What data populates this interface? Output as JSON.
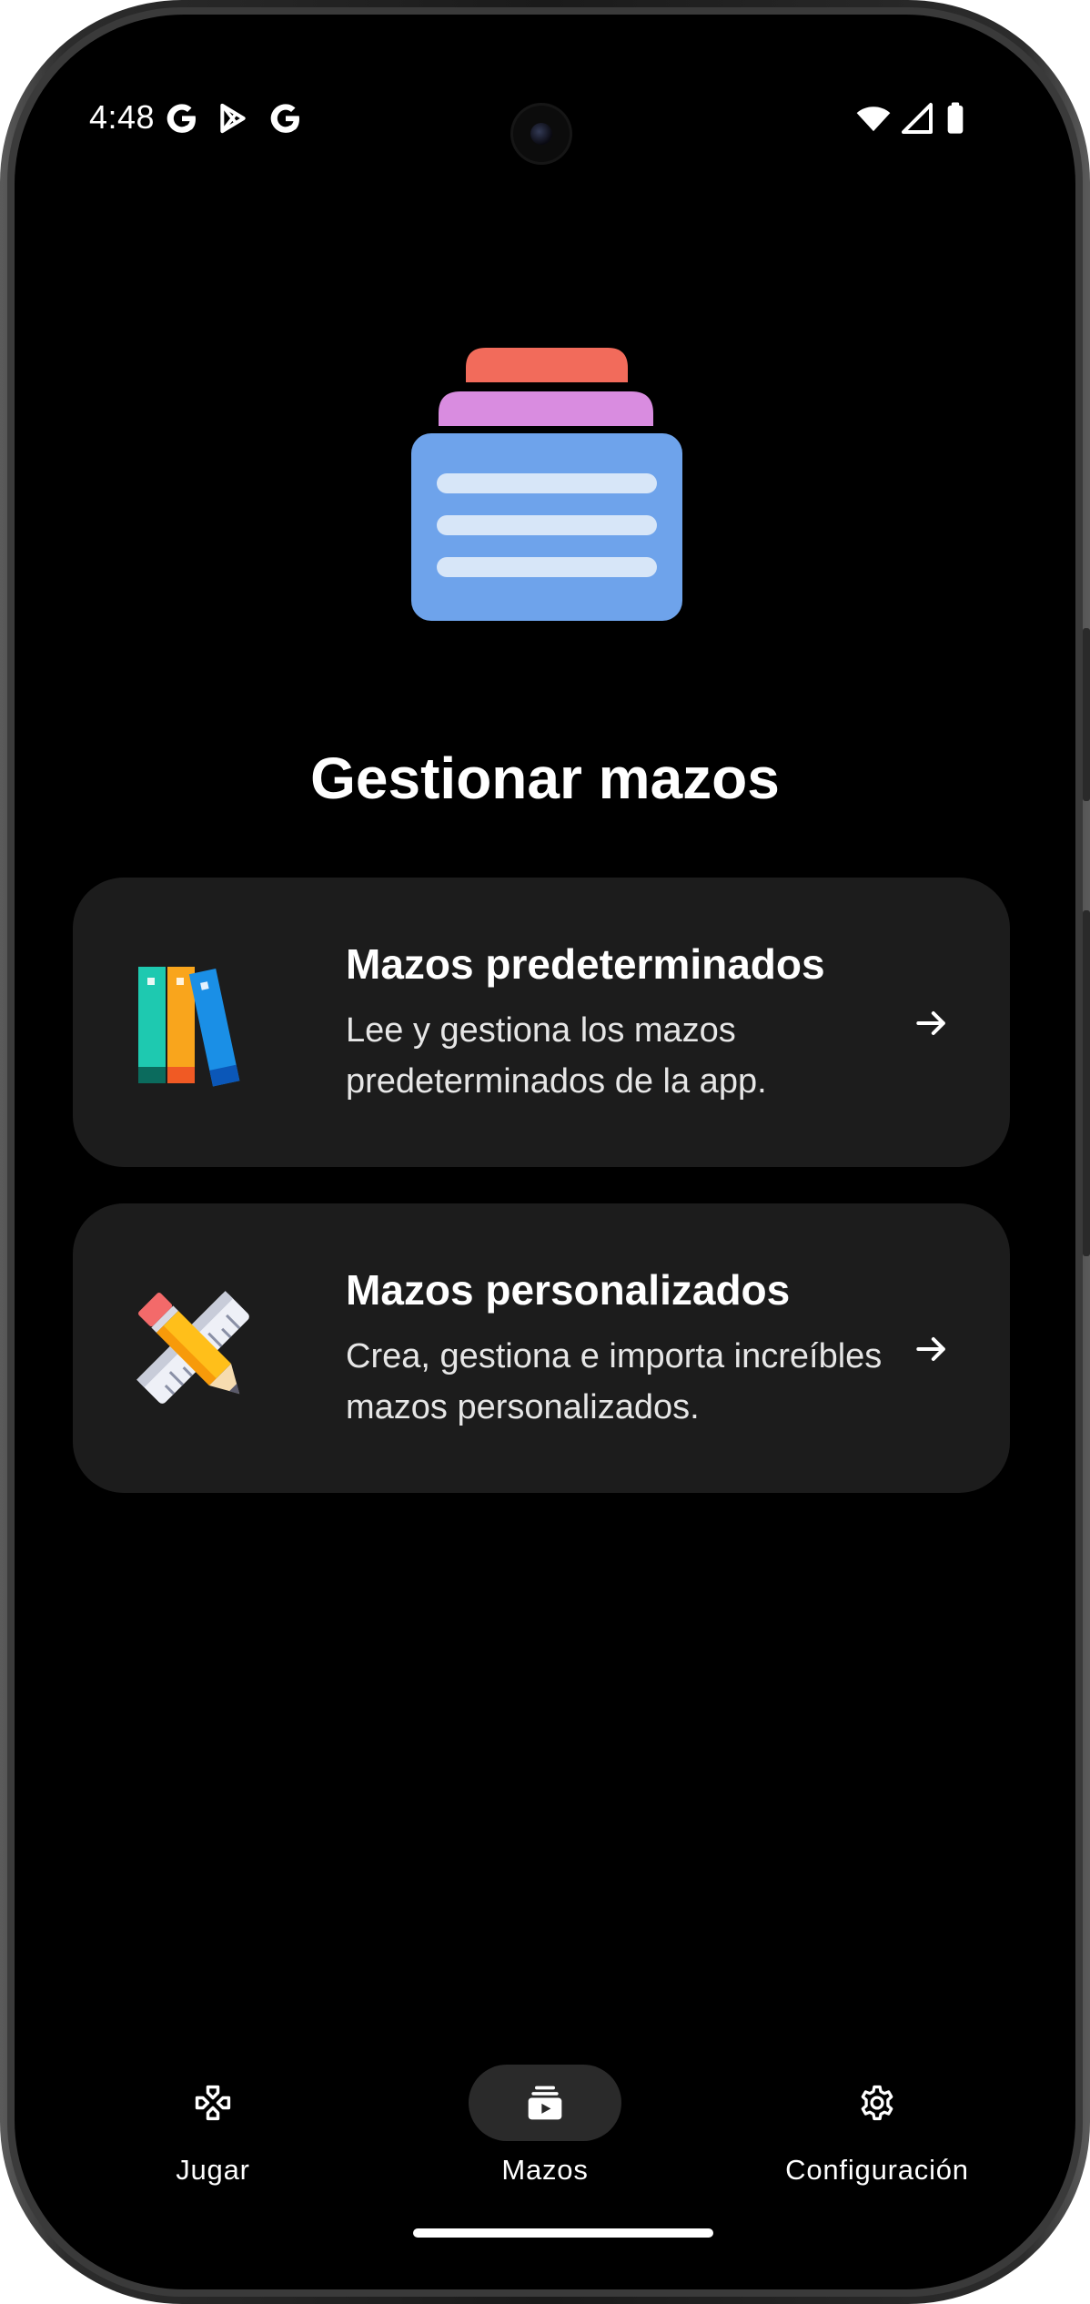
{
  "status_bar": {
    "time": "4:48",
    "left_icons": [
      "google-g-icon",
      "play-store-icon",
      "google-g-icon"
    ],
    "right_icons": [
      "wifi-icon",
      "cell-signal-icon",
      "battery-icon"
    ]
  },
  "main": {
    "hero_icon": "card-deck-icon",
    "title": "Gestionar mazos",
    "cards": [
      {
        "icon": "books-icon",
        "title": "Mazos predeterminados",
        "description": "Lee y gestiona los mazos predeterminados de la app.",
        "action_icon": "arrow-right-icon"
      },
      {
        "icon": "pencil-ruler-icon",
        "title": "Mazos personalizados",
        "description": "Crea, gestiona e importa increíbles mazos personalizados.",
        "action_icon": "arrow-right-icon"
      }
    ]
  },
  "bottom_nav": {
    "items": [
      {
        "label": "Jugar",
        "icon": "gamepad-icon",
        "active": false
      },
      {
        "label": "Mazos",
        "icon": "deck-play-icon",
        "active": true
      },
      {
        "label": "Configuración",
        "icon": "gear-icon",
        "active": false
      }
    ]
  },
  "colors": {
    "background": "#000000",
    "card": "#1c1c1c",
    "text": "#ffffff",
    "deck_top": "#f26b5b",
    "deck_middle": "#d98ce0",
    "deck_body": "#6ea3eb",
    "deck_lines": "#d7e6f8"
  }
}
